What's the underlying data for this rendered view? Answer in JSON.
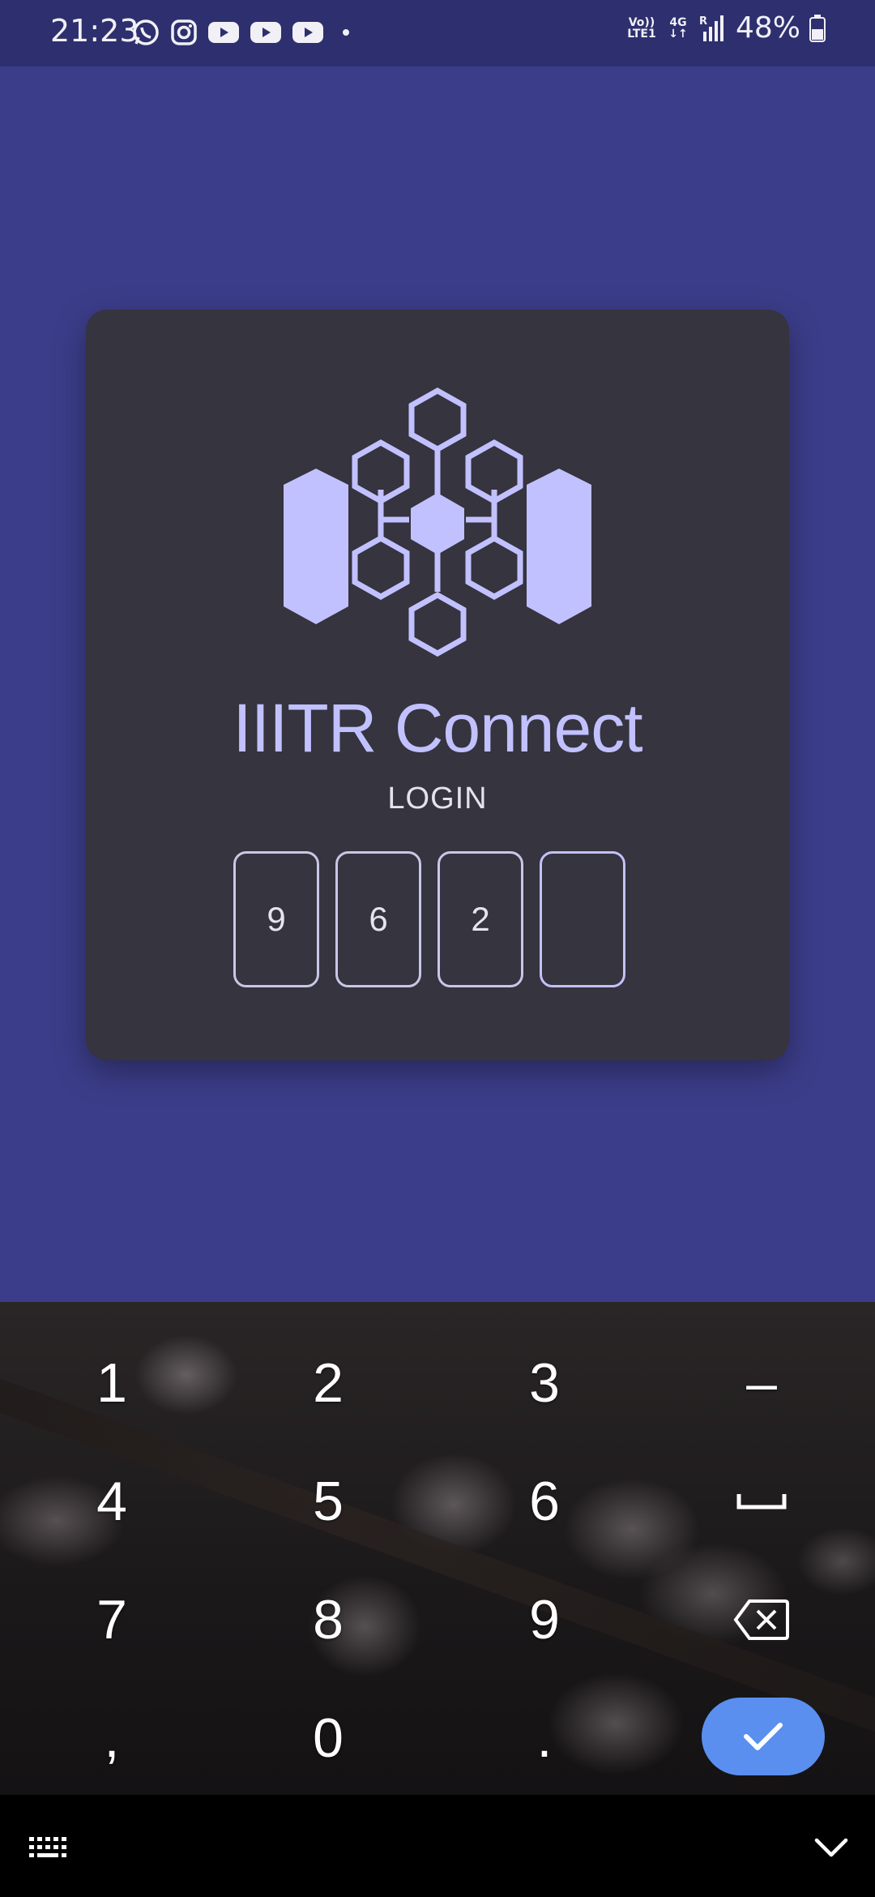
{
  "status_bar": {
    "time": "21:23",
    "notification_icons": [
      "whatsapp-icon",
      "instagram-icon",
      "youtube-icon",
      "youtube-icon",
      "youtube-icon",
      "dot-icon"
    ],
    "volte_label": "Vo))\nLTE1",
    "network_label": "4G",
    "roaming_label": "R",
    "battery_percent": "48%"
  },
  "app": {
    "title": "IIITR Connect",
    "subtitle": "LOGIN",
    "pin_digits": [
      "9",
      "6",
      "2",
      ""
    ],
    "accent_color": "#c2c1ff",
    "background_color": "#3c3d8a",
    "card_color": "#35343f"
  },
  "keyboard": {
    "keys": [
      [
        "1",
        "2",
        "3",
        "–"
      ],
      [
        "4",
        "5",
        "6",
        "space"
      ],
      [
        "7",
        "8",
        "9",
        "backspace"
      ],
      [
        ",",
        "0",
        ".",
        "done"
      ]
    ],
    "done_color": "#5a8ff0"
  },
  "nav_bar": {
    "keyboard_switch_icon": "keyboard-icon",
    "hide_keyboard_icon": "chevron-down-icon"
  }
}
